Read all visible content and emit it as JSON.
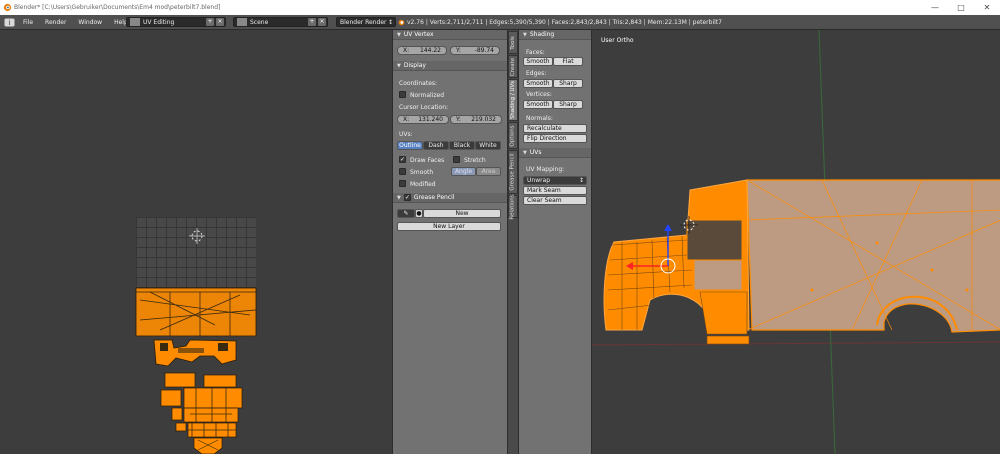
{
  "window": {
    "title": "Blender* [C:\\Users\\Gebruiker\\Documents\\Em4 mod\\peterbilt7.blend]",
    "minimize_icon": "minimize-icon",
    "maximize_icon": "maximize-icon",
    "close_icon": "close-icon"
  },
  "menubar": {
    "items": [
      "File",
      "Render",
      "Window",
      "Help"
    ],
    "screen_layout": "UV Editing",
    "scene": "Scene",
    "render_engine": "Blender Render",
    "stats": "v2.76 | Verts:2,711/2,711 | Edges:5,390/5,390 | Faces:2,843/2,843 | Tris:2,843 | Mem:22.13M | peterbilt7"
  },
  "uv_vertex": {
    "header": "UV Vertex",
    "x_label": "X:",
    "x_value": "144.22",
    "y_label": "Y:",
    "y_value": "-89.74"
  },
  "display": {
    "header": "Display",
    "coordinates_label": "Coordinates:",
    "normalized_label": "Normalized",
    "cursor_location_label": "Cursor Location:",
    "cursor_x_label": "X:",
    "cursor_x": "131.240",
    "cursor_y_label": "Y:",
    "cursor_y": "219.032",
    "uvs_label": "UVs:",
    "uv_modes": [
      "Outline",
      "Dash",
      "Black",
      "White"
    ],
    "draw_faces_label": "Draw Faces",
    "stretch_label": "Stretch",
    "smooth_label": "Smooth",
    "angle_label": "Angle",
    "area_label": "Area",
    "modified_label": "Modified"
  },
  "grease_pencil": {
    "header": "Grease Pencil",
    "new_label": "New",
    "new_layer_label": "New Layer"
  },
  "tabs": [
    "Tools",
    "Create",
    "Shading / UVs",
    "Options",
    "Grease Pencil",
    "Relations"
  ],
  "shading": {
    "header": "Shading",
    "faces_label": "Faces:",
    "faces_smooth": "Smooth",
    "faces_flat": "Flat",
    "edges_label": "Edges:",
    "edges_smooth": "Smooth",
    "edges_sharp": "Sharp",
    "vertices_label": "Vertices:",
    "vertices_smooth": "Smooth",
    "vertices_sharp": "Sharp",
    "normals_label": "Normals:",
    "recalculate": "Recalculate",
    "flip_direction": "Flip Direction"
  },
  "uvs_panel": {
    "header": "UVs",
    "uv_mapping_label": "UV Mapping:",
    "unwrap": "Unwrap",
    "mark_seam": "Mark Seam",
    "clear_seam": "Clear Seam"
  },
  "viewport": {
    "label": "User Ortho"
  },
  "colors": {
    "mesh_selected": "#ff8c00",
    "face_fill": "#bd9a82",
    "active_button": "#5680c2",
    "grid_bg": "#484848"
  }
}
